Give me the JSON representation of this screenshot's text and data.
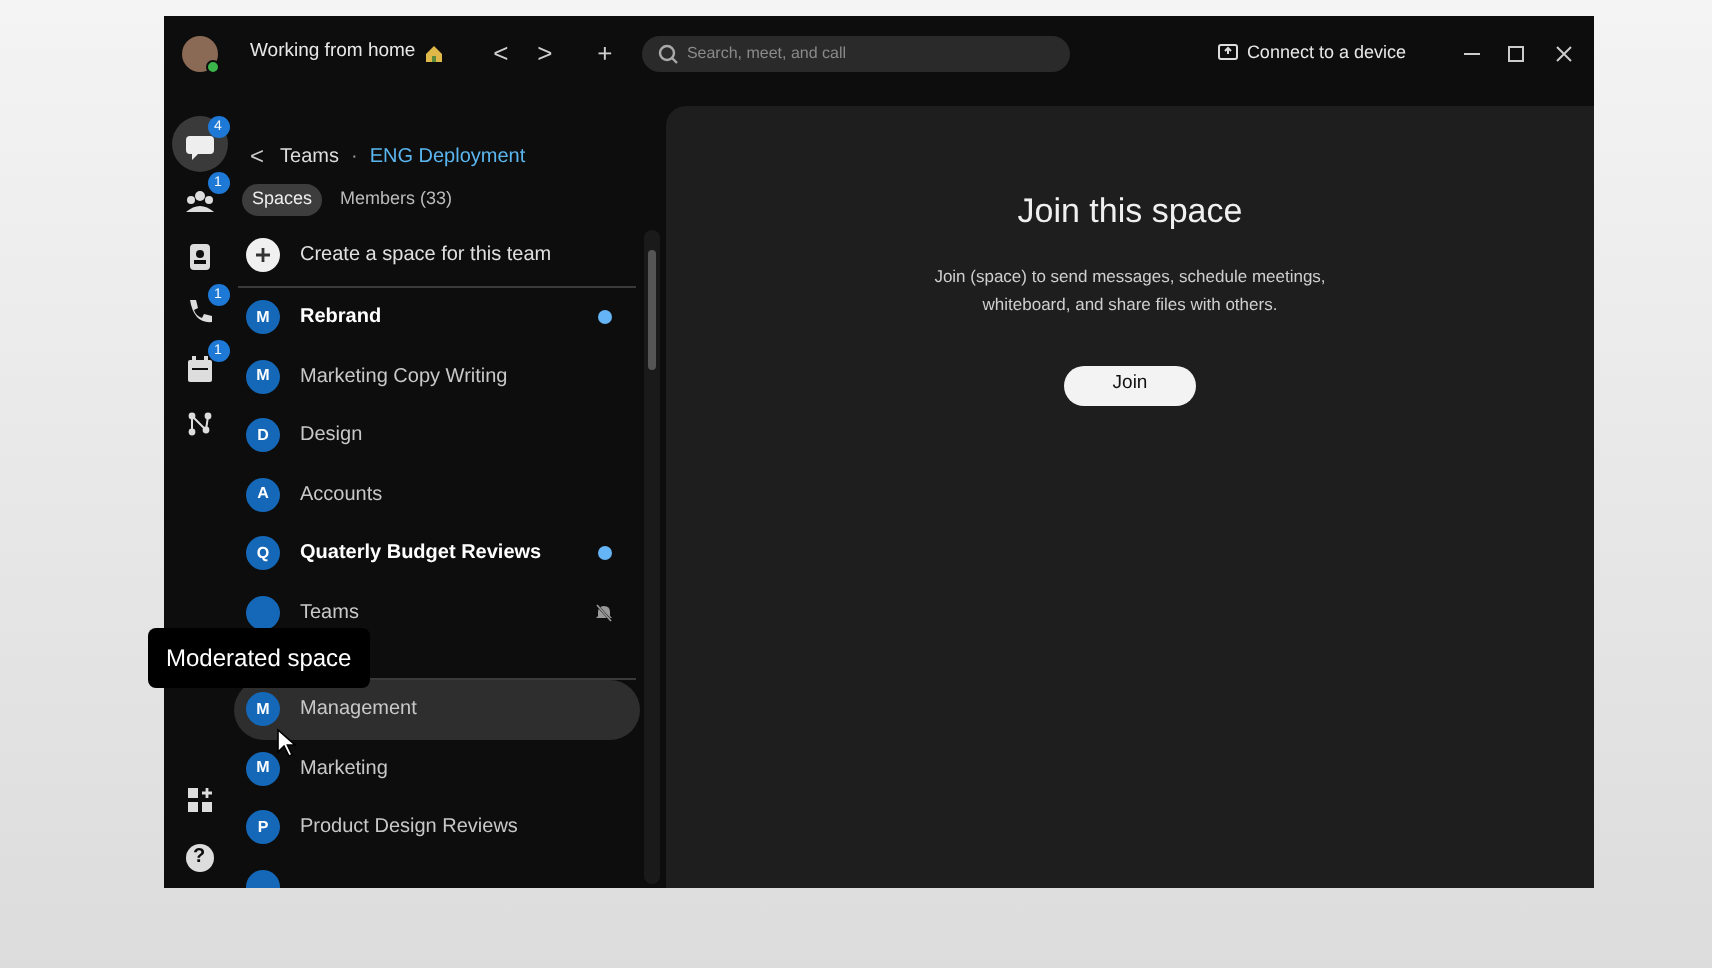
{
  "titlebar": {
    "status": "Working from home",
    "nav": [
      "<",
      ">",
      "+"
    ],
    "search_placeholder": "Search, meet, and call",
    "connect": "Connect to a device"
  },
  "rail": {
    "top": [
      {
        "kind": "chat",
        "badge": "4",
        "selected": true
      },
      {
        "kind": "teams",
        "badge": "1",
        "selected": false
      },
      {
        "kind": "contacts",
        "selected": false
      },
      {
        "kind": "calls",
        "badge": "1",
        "selected": false
      },
      {
        "kind": "calendar",
        "badge": "1",
        "selected": false
      },
      {
        "kind": "network",
        "selected": false
      }
    ],
    "bottom": [
      {
        "kind": "apps"
      },
      {
        "kind": "help",
        "glyph": "?"
      }
    ]
  },
  "breadcrumb": {
    "back": "<",
    "parent": "Teams",
    "separator": "·",
    "current": "ENG Deployment"
  },
  "tabs": [
    {
      "label": "Spaces",
      "selected": true
    },
    {
      "label": "Members (33)",
      "selected": false
    }
  ],
  "create": "Create a space for this team",
  "spaces": [
    {
      "letter": "M",
      "name": "Rebrand",
      "unread": true,
      "muted": false,
      "hovered": false
    },
    {
      "letter": "M",
      "name": "Marketing Copy Writing",
      "unread": false,
      "muted": false,
      "hovered": false
    },
    {
      "letter": "D",
      "name": "Design",
      "unread": false,
      "muted": false,
      "hovered": false
    },
    {
      "letter": "A",
      "name": "Accounts",
      "unread": false,
      "muted": false,
      "hovered": false
    },
    {
      "letter": "Q",
      "name": "Quaterly Budget Reviews",
      "unread": true,
      "muted": false,
      "hovered": false
    },
    {
      "name": "Teams",
      "unread": false,
      "muted": true,
      "hovered": false
    }
  ],
  "moderated_spaces": [
    {
      "letter": "M",
      "name": "Management",
      "unread": false,
      "muted": false,
      "hovered": true
    },
    {
      "letter": "M",
      "name": "Marketing",
      "unread": false,
      "muted": false,
      "hovered": false
    },
    {
      "letter": "P",
      "name": "Product Design Reviews",
      "unread": false,
      "muted": false,
      "hovered": false
    },
    {
      "unread": false,
      "muted": false,
      "hovered": false
    }
  ],
  "tooltip": "Moderated space",
  "main": {
    "title": "Join this space",
    "body": "Join (space) to send messages, schedule meetings,\nwhiteboard, and share files with others.",
    "button": "Join"
  }
}
